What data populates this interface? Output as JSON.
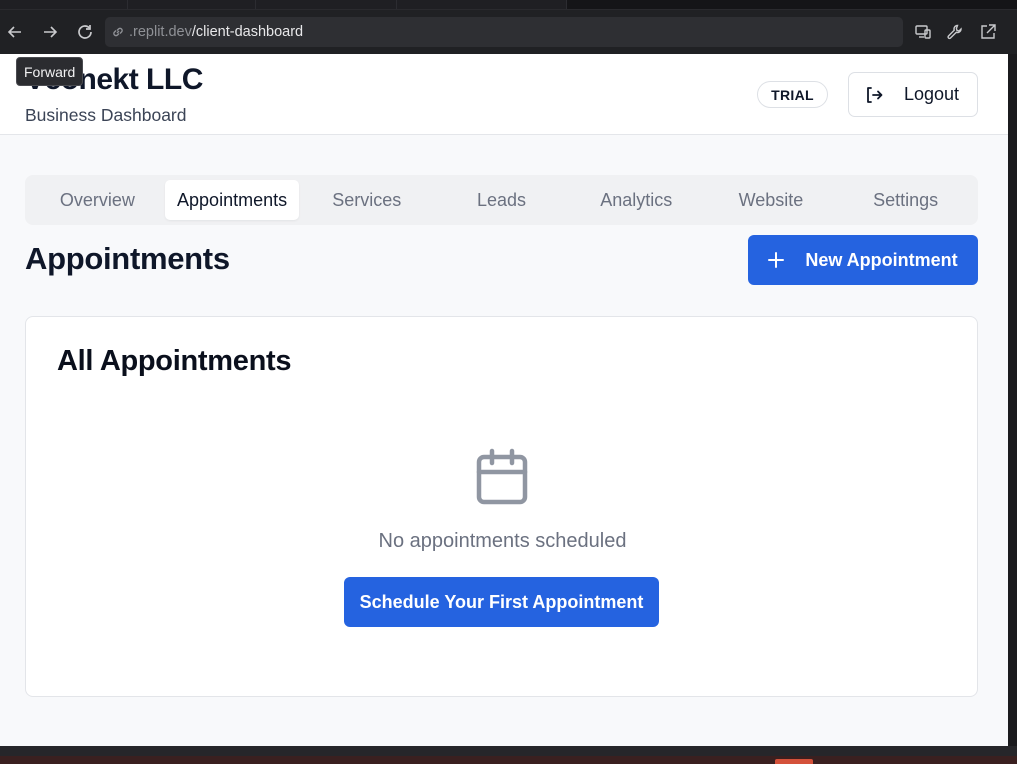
{
  "browser": {
    "url_prefix": ".replit.dev",
    "url_path": "/client-dashboard",
    "tooltip": "Forward",
    "nav_icons": [
      "back-arrow-icon",
      "forward-arrow-icon",
      "reload-icon"
    ],
    "right_icons": [
      "devices-icon",
      "wrench-icon",
      "open-external-icon"
    ]
  },
  "header": {
    "brand": "Vconekt LLC",
    "subtitle": "Business Dashboard",
    "badge": "TRIAL",
    "logout_label": "Logout"
  },
  "tabs": [
    {
      "label": "Overview",
      "active": false
    },
    {
      "label": "Appointments",
      "active": true
    },
    {
      "label": "Services",
      "active": false
    },
    {
      "label": "Leads",
      "active": false
    },
    {
      "label": "Analytics",
      "active": false
    },
    {
      "label": "Website",
      "active": false
    },
    {
      "label": "Settings",
      "active": false
    }
  ],
  "section": {
    "title": "Appointments",
    "new_button": "New Appointment"
  },
  "card": {
    "title": "All Appointments",
    "empty_text": "No appointments scheduled",
    "cta": "Schedule Your First Appointment"
  },
  "colors": {
    "primary": "#2563e0",
    "page_bg": "#f8f9fb",
    "text": "#0f1729",
    "muted": "#6b7180"
  }
}
